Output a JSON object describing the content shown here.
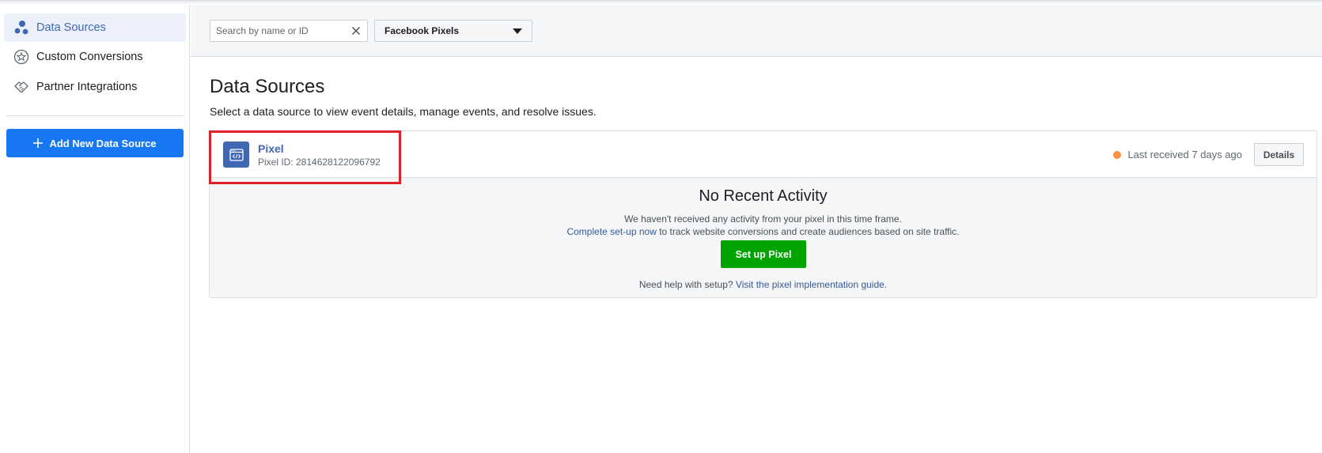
{
  "sidebar": {
    "items": [
      {
        "label": "Data Sources",
        "icon": "people-cluster-icon",
        "active": true
      },
      {
        "label": "Custom Conversions",
        "icon": "star-badge-icon",
        "active": false
      },
      {
        "label": "Partner Integrations",
        "icon": "handshake-icon",
        "active": false
      }
    ],
    "add_button": {
      "icon": "plus",
      "label": "Add New Data Source"
    }
  },
  "toolbar": {
    "search_placeholder": "Search by name or ID",
    "filter_selected": "Facebook Pixels"
  },
  "main": {
    "title": "Data Sources",
    "subtitle": "Select a data source to view event details, manage events, and resolve issues."
  },
  "pixel_card": {
    "name": "Pixel",
    "pixel_id": "Pixel ID: 2814628122096792",
    "status_text": "Last received 7 days ago",
    "status_color": "#f7923b",
    "details_label": "Details",
    "empty_title": "No Recent Activity",
    "empty_line1": "We haven't received any activity from your pixel in this time frame.",
    "empty_line2_link": "Complete set-up now",
    "empty_line2_rest": " to track website conversions and create audiences based on site traffic.",
    "setup_button": "Set up Pixel",
    "help_text": "Need help with setup? ",
    "help_link": "Visit the pixel implementation guide",
    "help_end": "."
  },
  "colors": {
    "accent": "#4267b2",
    "primary_button": "#1877f2",
    "success_button": "#00a400",
    "highlight_box": "#e02027"
  }
}
